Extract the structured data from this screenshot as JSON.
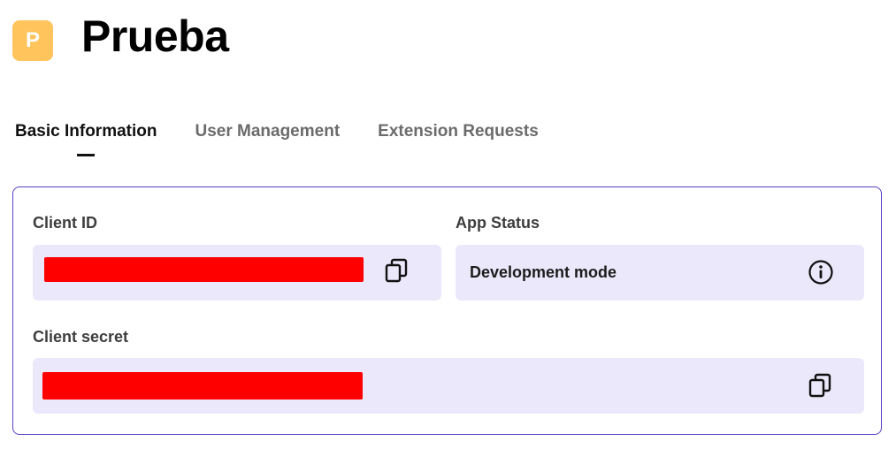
{
  "app": {
    "avatar_letter": "P",
    "avatar_color": "#ffc45c",
    "title": "Prueba"
  },
  "tabs": [
    {
      "label": "Basic Information",
      "active": true
    },
    {
      "label": "User Management",
      "active": false
    },
    {
      "label": "Extension Requests",
      "active": false
    }
  ],
  "card": {
    "border_color": "#5b3fc4",
    "client_id": {
      "label": "Client ID",
      "value_redacted": true,
      "copy_icon": "copy-icon"
    },
    "app_status": {
      "label": "App Status",
      "value": "Development mode",
      "info_icon": "info-icon"
    },
    "client_secret": {
      "label": "Client secret",
      "value_redacted": true,
      "copy_icon": "copy-icon"
    }
  },
  "colors": {
    "field_background": "#ece8fb",
    "redaction": "#ff0000",
    "inactive_tab": "#6b6b6b",
    "active_tab": "#111111"
  }
}
